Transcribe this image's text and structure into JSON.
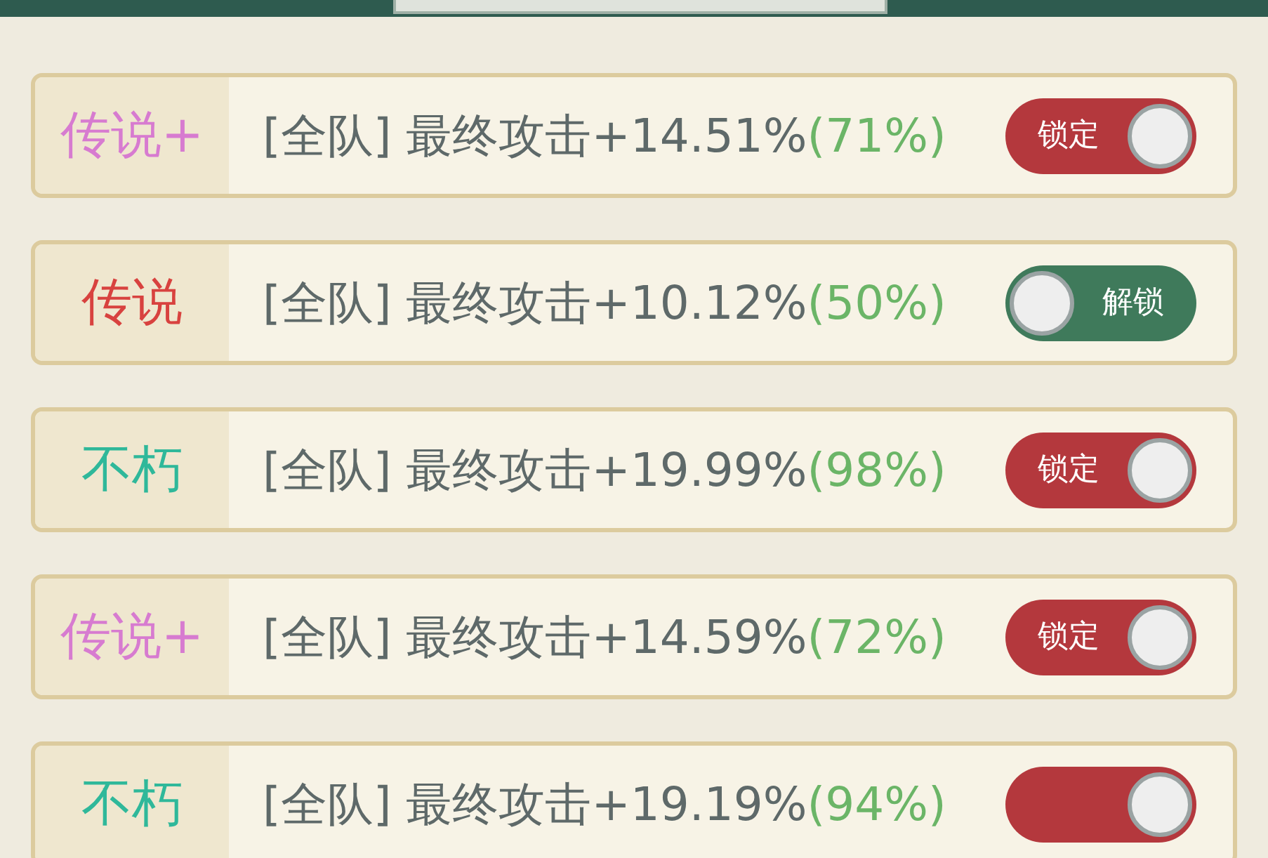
{
  "rows": [
    {
      "grade": {
        "text": "传说+",
        "color": "#d77bd0"
      },
      "stat": "[全队] 最终攻击+14.51%",
      "percent": "(71%)",
      "lock": {
        "label": "锁定",
        "locked": true
      }
    },
    {
      "grade": {
        "text": "传说",
        "color": "#d8423f"
      },
      "stat": "[全队] 最终攻击+10.12%",
      "percent": "(50%)",
      "lock": {
        "label": "解锁",
        "locked": false
      }
    },
    {
      "grade": {
        "text": "不朽",
        "color": "#2fb89a"
      },
      "stat": "[全队] 最终攻击+19.99%",
      "percent": "(98%)",
      "lock": {
        "label": "锁定",
        "locked": true
      }
    },
    {
      "grade": {
        "text": "传说+",
        "color": "#d77bd0"
      },
      "stat": "[全队] 最终攻击+14.59%",
      "percent": "(72%)",
      "lock": {
        "label": "锁定",
        "locked": true
      }
    },
    {
      "grade": {
        "text": "不朽",
        "color": "#2fb89a"
      },
      "stat": "[全队] 最终攻击+19.19%",
      "percent": "(94%)",
      "lock": {
        "locked": true
      }
    }
  ]
}
